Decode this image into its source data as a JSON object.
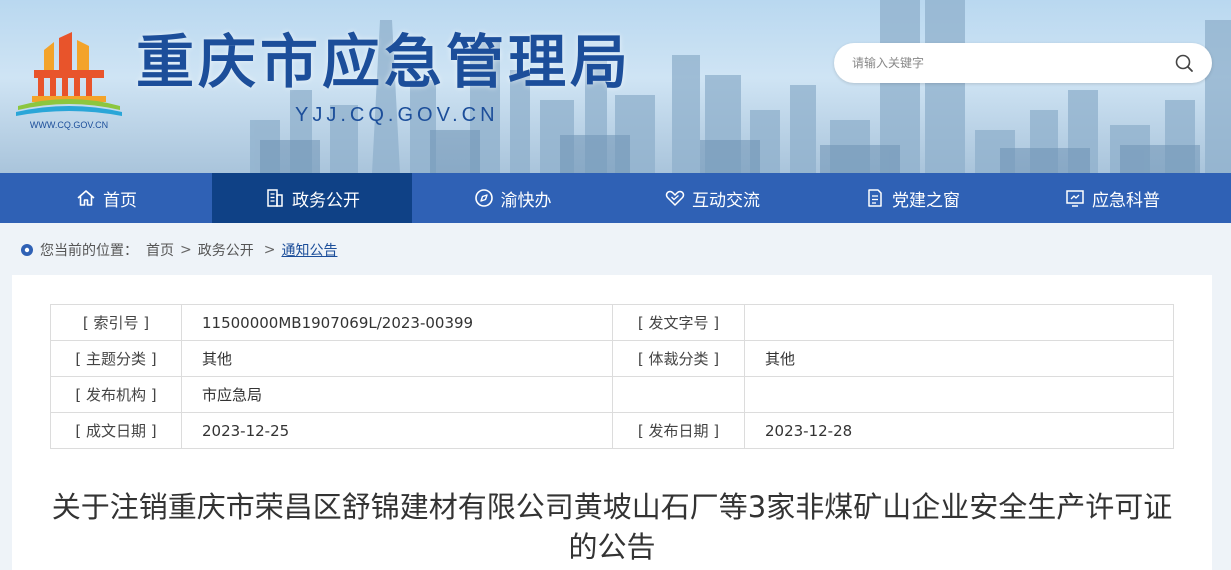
{
  "header": {
    "logo_url_text": "WWW.CQ.GOV.CN",
    "site_name": "重庆市应急管理局",
    "site_url": "YJJ.CQ.GOV.CN"
  },
  "search": {
    "placeholder": "请输入关键字"
  },
  "nav": {
    "items": [
      {
        "label": "首页",
        "icon": "home-icon"
      },
      {
        "label": "政务公开",
        "icon": "building-icon"
      },
      {
        "label": "渝快办",
        "icon": "compass-icon"
      },
      {
        "label": "互动交流",
        "icon": "handshake-icon"
      },
      {
        "label": "党建之窗",
        "icon": "document-icon"
      },
      {
        "label": "应急科普",
        "icon": "screen-icon"
      }
    ],
    "active_index": 1
  },
  "breadcrumb": {
    "prefix": "您当前的位置：",
    "items": [
      "首页",
      "政务公开",
      "通知公告"
    ],
    "separator": ">"
  },
  "meta": {
    "index_no_label": "[ 索引号 ]",
    "index_no": "11500000MB1907069L/2023-00399",
    "doc_no_label": "[ 发文字号 ]",
    "doc_no": "",
    "topic_label": "[ 主题分类 ]",
    "topic": "其他",
    "genre_label": "[ 体裁分类 ]",
    "genre": "其他",
    "issuer_label": "[ 发布机构 ]",
    "issuer": "市应急局",
    "created_label": "[ 成文日期 ]",
    "created": "2023-12-25",
    "published_label": "[ 发布日期 ]",
    "published": "2023-12-28"
  },
  "article": {
    "title": "关于注销重庆市荣昌区舒锦建材有限公司黄坡山石厂等3家非煤矿山企业安全生产许可证的公告"
  },
  "colors": {
    "nav_bg": "#2f61b5",
    "nav_active": "#0f4186",
    "brand_blue": "#1c4e9a"
  }
}
